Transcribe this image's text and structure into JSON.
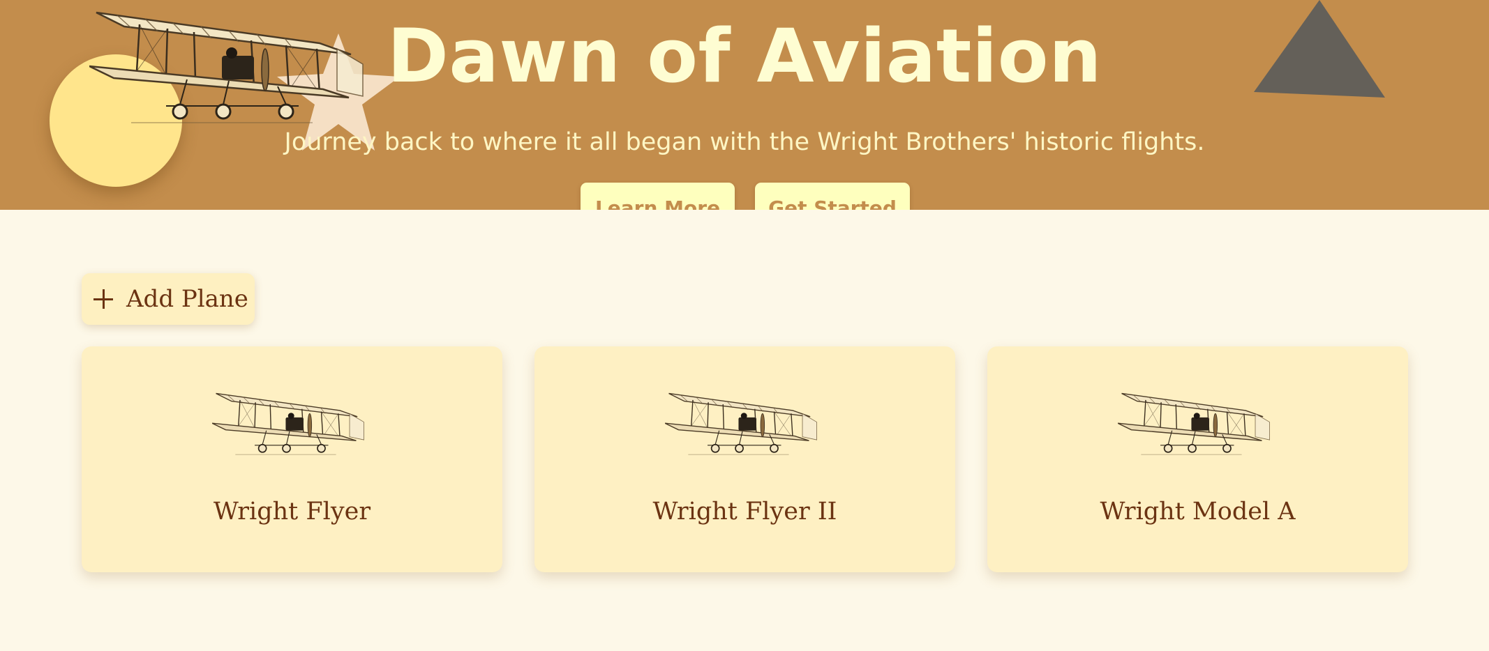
{
  "hero": {
    "title": "Dawn of Aviation",
    "subtitle": "Journey back to where it all began with the Wright Brothers' historic flights.",
    "buttons": {
      "learn_more": "Learn More",
      "get_started": "Get Started"
    }
  },
  "toolbar": {
    "add_plane_label": "Add Plane",
    "add_icon": "plus-icon"
  },
  "planes": [
    {
      "name": "Wright Flyer",
      "icon": "biplane-illustration"
    },
    {
      "name": "Wright Flyer II",
      "icon": "biplane-illustration"
    },
    {
      "name": "Wright Model A",
      "icon": "biplane-illustration"
    }
  ],
  "colors": {
    "hero_background": "#c38d4c",
    "hero_text": "#fefdd2",
    "page_background": "#fdf8e8",
    "card_background": "#fef0c3",
    "card_text": "#6b3312",
    "sun": "#ffe58c",
    "triangle": "#646059",
    "hero_button_background": "#feffbe"
  }
}
